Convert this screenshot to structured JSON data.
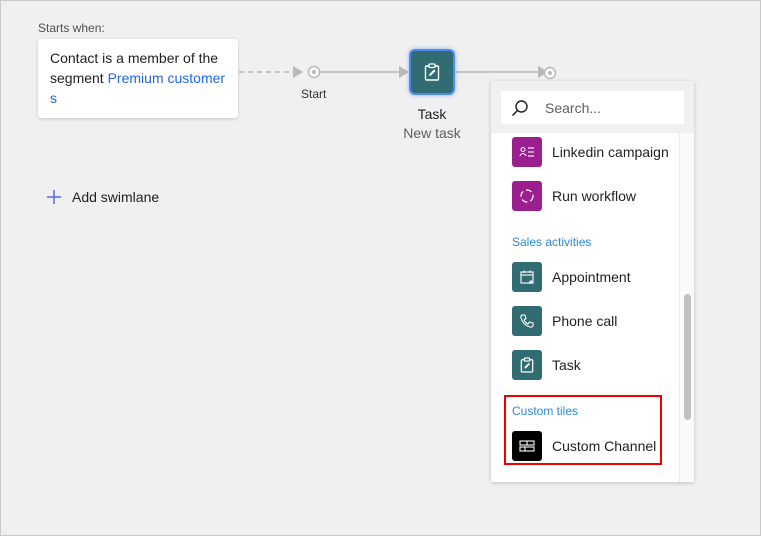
{
  "trigger": {
    "starts_when_label": "Starts when:",
    "text_prefix": "Contact is a member of the segment ",
    "segment_link": "Premium customers"
  },
  "flow": {
    "start_label": "Start",
    "task_node": {
      "icon": "clipboard-edit-icon",
      "title": "Task",
      "subtitle": "New task",
      "color": "#316c72"
    }
  },
  "add_swimlane_label": "Add swimlane",
  "panel": {
    "search_placeholder": "Search...",
    "items_before": [
      {
        "label": "Linkedin campaign",
        "icon": "contact-list-icon",
        "color": "#9b1f8e"
      },
      {
        "label": "Run workflow",
        "icon": "refresh-dashed-icon",
        "color": "#9b1f8e"
      }
    ],
    "sales_section": "Sales activities",
    "sales_items": [
      {
        "label": "Appointment",
        "icon": "calendar-icon",
        "color": "#316c72"
      },
      {
        "label": "Phone call",
        "icon": "phone-icon",
        "color": "#316c72"
      },
      {
        "label": "Task",
        "icon": "clipboard-edit-icon",
        "color": "#316c72"
      }
    ],
    "custom_section": "Custom tiles",
    "custom_items": [
      {
        "label": "Custom Channel",
        "icon": "tiles-icon",
        "color": "#000000"
      }
    ]
  },
  "colors": {
    "link": "#2266e3",
    "section_header": "#2b88d8",
    "highlight_border": "#ee0000",
    "add_icon": "#4f6bed"
  }
}
